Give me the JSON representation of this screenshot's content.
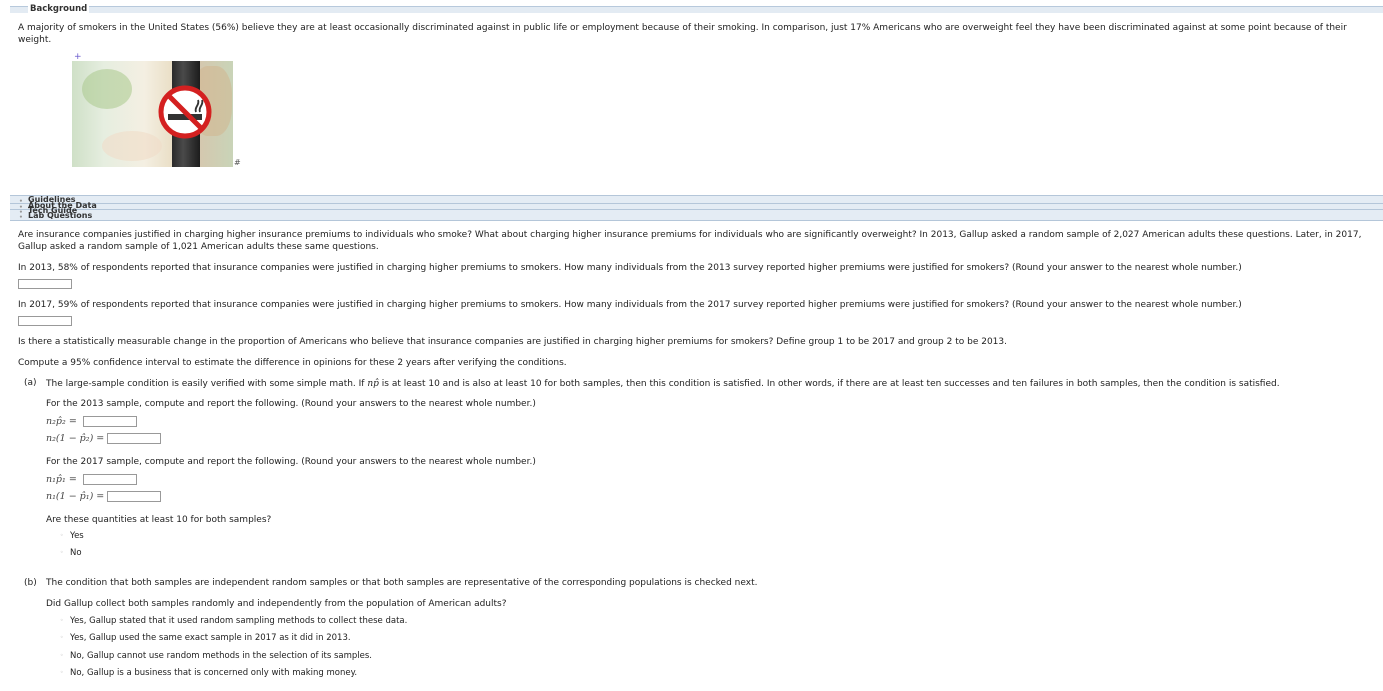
{
  "background": {
    "label": "Background",
    "text": "A majority of smokers in the United States (56%) believe they are at least occasionally discriminated against in public life or employment because of their smoking. In comparison, just 17% Americans who are overweight feel they have been discriminated against at some point because of their weight.",
    "image_icon": "no-smoking-icon"
  },
  "tabs": [
    "Guidelines",
    "About the Data",
    "Tech Guide",
    "Lab Questions"
  ],
  "intro": "Are insurance companies justified in charging higher insurance premiums to individuals who smoke? What about charging higher insurance premiums for individuals who are significantly overweight? In 2013, Gallup asked a random sample of 2,027 American adults these questions. Later, in 2017, Gallup asked a random sample of 1,021 American adults these same questions.",
  "q2013": "In 2013, 58% of respondents reported that insurance companies were justified in charging higher premiums to smokers. How many individuals from the 2013 survey reported higher premiums were justified for smokers? (Round your answer to the nearest whole number.)",
  "q2017": "In 2017, 59% of respondents reported that insurance companies were justified in charging higher premiums to smokers. How many individuals from the 2017 survey reported higher premiums were justified for smokers? (Round your answer to the nearest whole number.)",
  "change_q": "Is there a statistically measurable change in the proportion of Americans who believe that insurance companies are justified in charging higher premiums for smokers? Define group 1 to be 2017 and group 2 to be 2013.",
  "compute_ci": "Compute a 95% confidence interval to estimate the difference in opinions for these 2 years after verifying the conditions.",
  "part_a": {
    "label": "(a)",
    "text_before": "The large-sample condition is easily verified with some simple math. If ",
    "text_math": "np̂",
    "text_after": " is at least 10 and is also at least 10 for both samples, then this condition is satisfied. In other words, if there are at least ten successes and ten failures in both samples, then the condition is satisfied.",
    "sample2013_prompt": "For the 2013 sample, compute and report the following. (Round your answers to the nearest whole number.)",
    "expr_n2p2": "n₂p̂₂ =",
    "expr_n2q2": "n₂(1 − p̂₂) =",
    "sample2017_prompt": "For the 2017 sample, compute and report the following. (Round your answers to the nearest whole number.)",
    "expr_n1p1": "n₁p̂₁ =",
    "expr_n1q1": "n₁(1 − p̂₁) =",
    "at_least_q": "Are these quantities at least 10 for both samples?",
    "options": [
      "Yes",
      "No"
    ]
  },
  "part_b": {
    "label": "(b)",
    "text": "The condition that both samples are independent random samples or that both samples are representative of the corresponding populations is checked next.",
    "question": "Did Gallup collect both samples randomly and independently from the population of American adults?",
    "options": [
      "Yes, Gallup stated that it used random sampling methods to collect these data.",
      "Yes, Gallup used the same exact sample in 2017 as it did in 2013.",
      "No, Gallup cannot use random methods in the selection of its samples.",
      "No, Gallup is a business that is concerned only with making money."
    ]
  }
}
